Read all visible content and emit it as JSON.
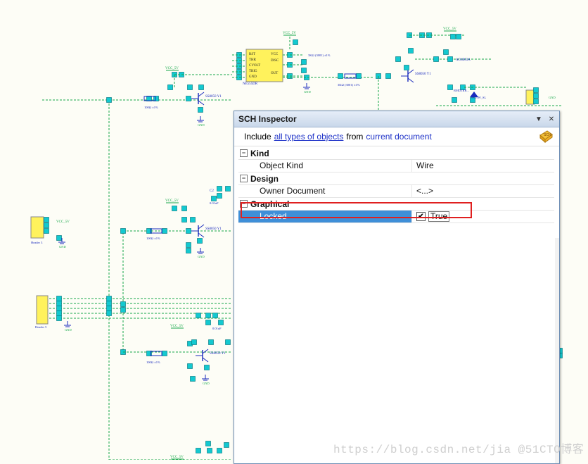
{
  "inspector": {
    "title": "SCH Inspector",
    "filter": {
      "include_label": "Include",
      "types_link": "all types of objects",
      "from_label": "from",
      "scope_link": "current document"
    },
    "categories": [
      {
        "label": "Kind",
        "rows": [
          {
            "name": "Object Kind",
            "value": "Wire"
          }
        ]
      },
      {
        "label": "Design",
        "rows": [
          {
            "name": "Owner Document",
            "value": "<...>"
          }
        ]
      },
      {
        "label": "Graphical",
        "rows": [
          {
            "name": "Locked",
            "value": "True",
            "checked": true
          }
        ]
      }
    ]
  },
  "schematic_labels": {
    "vcc": "VCC_5V",
    "transistor": "SS8050 Y1",
    "gnd": "GND",
    "ic": "NE555DR",
    "res": "100Ω ±1%",
    "cap": "0.01uF",
    "header": "Header 5"
  },
  "watermark": "https://blog.csdn.net/jia @51CTO博客",
  "colors": {
    "wire": "#17a84a",
    "pin": "#13c9d0",
    "comp": "#1a2bbd",
    "highlight": "#3f8fd8",
    "callout": "#e02020"
  }
}
